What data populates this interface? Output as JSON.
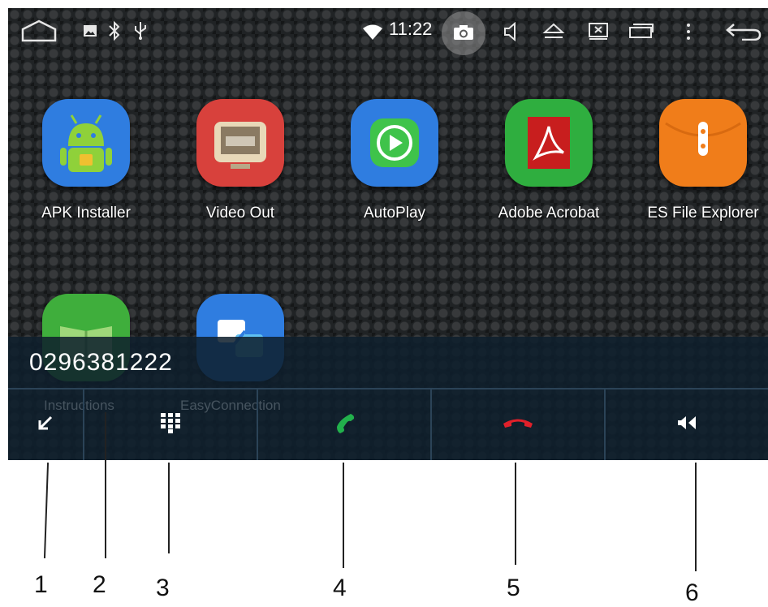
{
  "status_bar": {
    "time": "11:22",
    "icons": [
      "home-outline-icon",
      "image-icon",
      "bluetooth-icon",
      "usb-icon",
      "wifi-icon",
      "camera-icon",
      "volume-icon",
      "eject-icon",
      "screen-icon",
      "window-icon",
      "more-icon",
      "back-icon"
    ]
  },
  "apps": [
    {
      "label": "APK Installer",
      "icon": "android-robot-icon",
      "color": "#2f7de0"
    },
    {
      "label": "Video Out",
      "icon": "tv-screen-icon",
      "color": "#d8413c"
    },
    {
      "label": "AutoPlay",
      "icon": "play-circle-icon",
      "color": "#2f7de0"
    },
    {
      "label": "Adobe Acrobat",
      "icon": "acrobat-icon",
      "color": "#2fae3f"
    },
    {
      "label": "ES File Explorer",
      "icon": "folder-zip-icon",
      "color": "#f07d1a"
    },
    {
      "label": "Instructions",
      "icon": "book-icon",
      "color": "#3fae3c"
    },
    {
      "label": "EasyConnection",
      "icon": "connection-icon",
      "color": "#2f7de0"
    }
  ],
  "call_panel": {
    "number": "0296381222",
    "buttons": [
      {
        "icon": "minimize-arrow-icon"
      },
      {
        "icon": "dialpad-icon"
      },
      {
        "icon": "answer-call-icon",
        "color": "#22b14c"
      },
      {
        "icon": "end-call-icon",
        "color": "#e0202a"
      },
      {
        "icon": "speaker-mute-icon"
      }
    ]
  },
  "callouts": [
    "1",
    "2",
    "3",
    "4",
    "5",
    "6"
  ]
}
